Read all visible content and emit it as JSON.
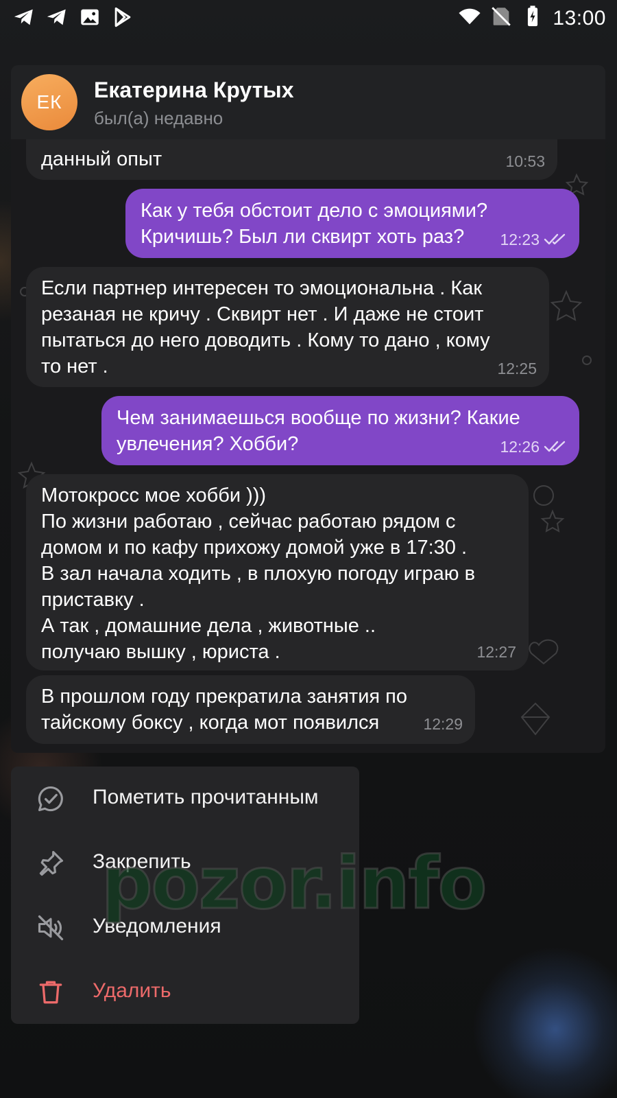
{
  "status_bar": {
    "time": "13:00",
    "left_icons": [
      "telegram-icon",
      "telegram-icon",
      "gallery-icon",
      "play-store-icon"
    ],
    "right_icons": [
      "wifi-icon",
      "no-sim-icon",
      "battery-charging-icon"
    ]
  },
  "chat": {
    "avatar_initials": "ЕК",
    "contact_name": "Екатерина Крутых",
    "contact_status": "был(а) недавно",
    "messages": [
      {
        "dir": "in",
        "text": "данный опыт",
        "time": "10:53"
      },
      {
        "dir": "out",
        "text": "Как у тебя обстоит дело с эмоциями?\nКричишь? Был ли сквирт хоть раз?",
        "time": "12:23",
        "read": true
      },
      {
        "dir": "in",
        "text": "Если партнер интересен то эмоциональна . Как\nрезаная не кричу . Сквирт нет . И даже не стоит\nпытаться до него доводить . Кому то дано , кому\nто нет .",
        "time": "12:25"
      },
      {
        "dir": "out",
        "text": "Чем занимаешься вообще по жизни? Какие\nувлечения? Хобби?",
        "time": "12:26",
        "read": true
      },
      {
        "dir": "in",
        "text": "Мотокросс мое хобби )))\nПо жизни работаю , сейчас работаю рядом с\nдомом и по кафу прихожу домой уже в 17:30 .\nВ зал начала ходить , в плохую погоду играю в\nприставку .\nА так , домашние дела , животные ..\nполучаю вышку , юриста .",
        "time": "12:27"
      },
      {
        "dir": "in",
        "text": "В прошлом году прекратила занятия по\nтайскому боксу , когда мот появился",
        "time": "12:29"
      }
    ]
  },
  "menu": {
    "items": [
      {
        "label": "Пометить прочитанным",
        "icon": "mark-read-icon"
      },
      {
        "label": "Закрепить",
        "icon": "pin-icon"
      },
      {
        "label": "Уведомления",
        "icon": "mute-icon"
      },
      {
        "label": "Удалить",
        "icon": "trash-icon"
      }
    ]
  },
  "watermark": "pozor.info",
  "colors": {
    "outgoing_bubble": "#8147c7",
    "incoming_bubble": "#262628",
    "delete_text": "#ec6a6a",
    "avatar": "#f0994a"
  }
}
